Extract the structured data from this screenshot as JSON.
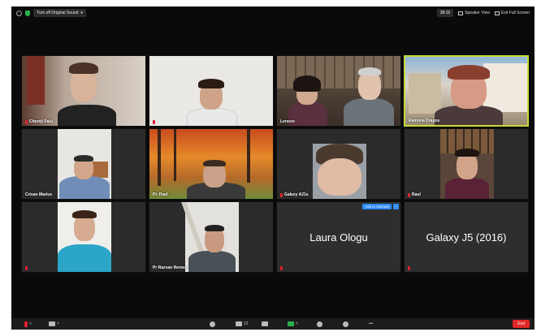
{
  "topbar": {
    "original_sound": "Turn off Original Sound",
    "timer": "38:16",
    "speaker_view": "Speaker View",
    "exit_full": "Exit Full Screen"
  },
  "tiles": [
    {
      "name": "Chereji Paul",
      "muted": true
    },
    {
      "name": "",
      "muted": true
    },
    {
      "name": "Lenovo",
      "muted": false
    },
    {
      "name": "Ramona Dragos",
      "muted": false,
      "active": true
    },
    {
      "name": "Crisan Marius",
      "muted": false
    },
    {
      "name": "Pr. Paul",
      "muted": false
    },
    {
      "name": "Galaxy A21s",
      "muted": true
    },
    {
      "name": "Raul",
      "muted": true
    },
    {
      "name": "",
      "muted": true
    },
    {
      "name": "Pr Razvan Remes",
      "muted": false
    },
    {
      "name": "Laura Ologu",
      "muted": true,
      "no_video": true,
      "unmute_label": "Ask to Unmute"
    },
    {
      "name": "Galaxy J5 (2016)",
      "muted": true,
      "no_video": true
    }
  ],
  "bottombar": {
    "participants_count": "12",
    "end_label": "End"
  },
  "colors": {
    "active_border": "#c9d83c",
    "accent_blue": "#2d8cff",
    "end_red": "#e02828",
    "muted_red": "#d22233"
  }
}
